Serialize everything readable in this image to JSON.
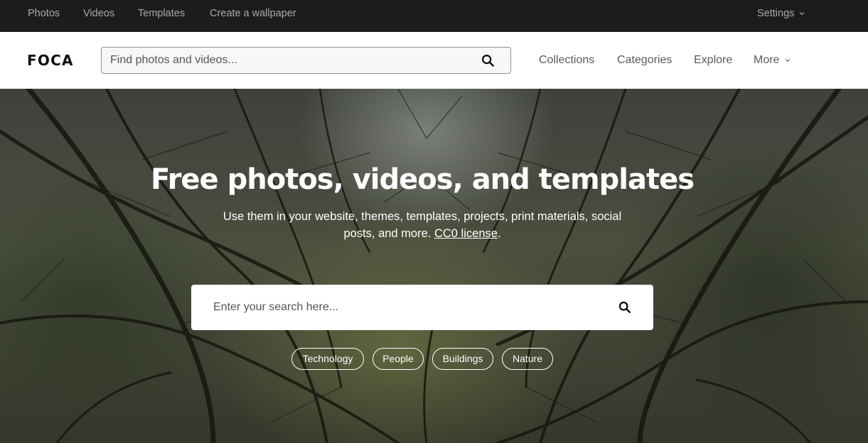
{
  "topbar": {
    "links": [
      "Photos",
      "Videos",
      "Templates",
      "Create a wallpaper"
    ],
    "settings_label": "Settings"
  },
  "header": {
    "logo": "FOCA",
    "search_placeholder": "Find photos and videos...",
    "nav": [
      "Collections",
      "Categories",
      "Explore",
      "More"
    ]
  },
  "hero": {
    "headline": "Free photos, videos, and templates",
    "subtitle_text": "Use them in your website, themes, templates, projects, print materials, social posts, and more.",
    "license_link": "CC0 license",
    "license_trailing": ".",
    "search_placeholder": "Enter your search here...",
    "chips": [
      "Technology",
      "People",
      "Buildings",
      "Nature"
    ]
  },
  "icons": {
    "search": "search-icon",
    "chevron": "chevron-down-icon"
  },
  "colors": {
    "topbar_bg": "#1c1c1c",
    "topbar_text": "#a9a9a9",
    "header_bg": "#ffffff",
    "logo": "#111111",
    "nav_text": "#5a5a5a",
    "hero_text": "#ffffff"
  }
}
